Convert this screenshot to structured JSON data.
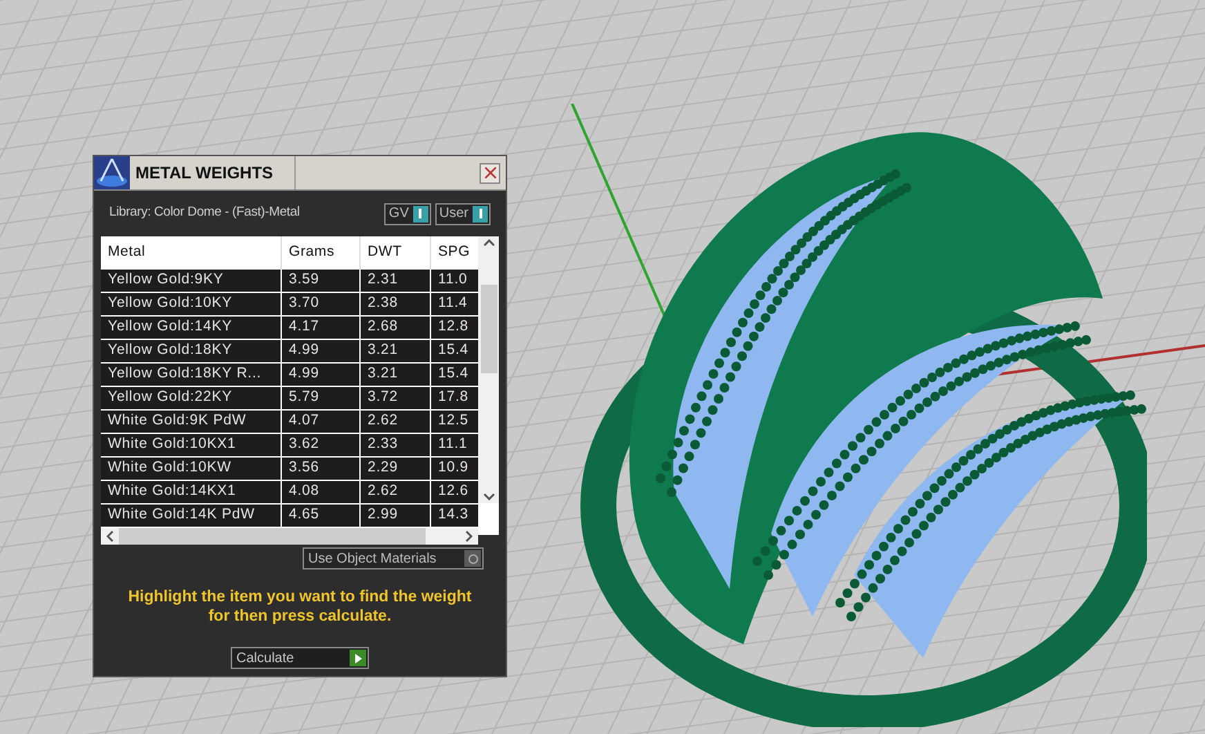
{
  "window": {
    "title": "METAL WEIGHTS"
  },
  "library": "Library: Color Dome - (Fast)-Metal",
  "toggles": [
    {
      "label": "GV",
      "on": true
    },
    {
      "label": "User",
      "on": true
    }
  ],
  "table": {
    "columns": [
      "Metal",
      "Grams",
      "DWT",
      "SPG"
    ],
    "rows": [
      [
        "Yellow Gold:9KY",
        "3.59",
        "2.31",
        "11.0"
      ],
      [
        "Yellow Gold:10KY",
        "3.70",
        "2.38",
        "11.4"
      ],
      [
        "Yellow Gold:14KY",
        "4.17",
        "2.68",
        "12.8"
      ],
      [
        "Yellow Gold:18KY",
        "4.99",
        "3.21",
        "15.4"
      ],
      [
        "Yellow Gold:18KY R...",
        "4.99",
        "3.21",
        "15.4"
      ],
      [
        "Yellow Gold:22KY",
        "5.79",
        "3.72",
        "17.8"
      ],
      [
        "White Gold:9K PdW",
        "4.07",
        "2.62",
        "12.5"
      ],
      [
        "White Gold:10KX1",
        "3.62",
        "2.33",
        "11.1"
      ],
      [
        "White Gold:10KW",
        "3.56",
        "2.29",
        "10.9"
      ],
      [
        "White Gold:14KX1",
        "4.08",
        "2.62",
        "12.6"
      ],
      [
        "White Gold:14K PdW",
        "4.65",
        "2.99",
        "14.3"
      ]
    ]
  },
  "use_object_materials": {
    "label": "Use Object Materials",
    "on": false
  },
  "hint": "Highlight the item you want to find the weight for then press calculate.",
  "calculate_button": "Calculate"
}
